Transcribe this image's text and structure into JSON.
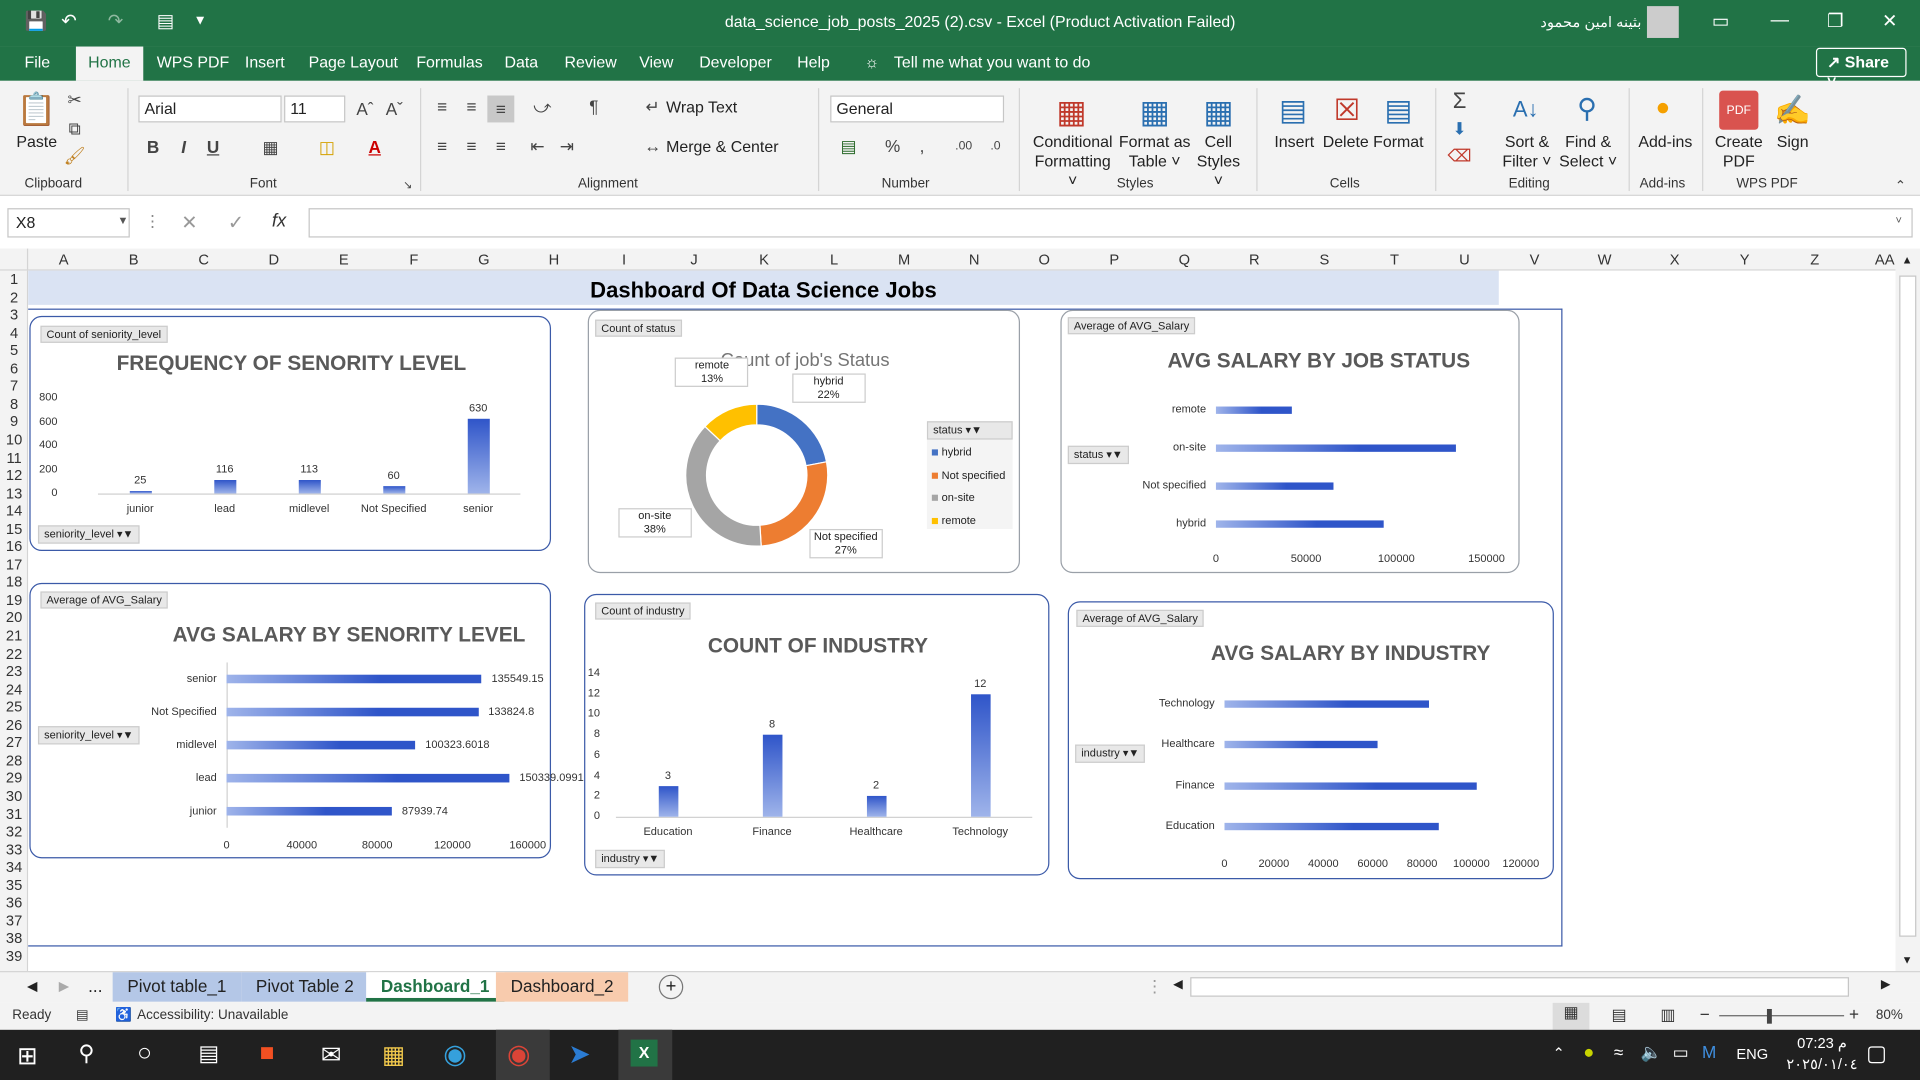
{
  "window": {
    "title": "data_science_job_posts_2025 (2).csv  -  Excel (Product Activation Failed)",
    "user": "بثينه امين محمود"
  },
  "menu": {
    "file": "File",
    "home": "Home",
    "wps_pdf": "WPS PDF",
    "insert": "Insert",
    "page_layout": "Page Layout",
    "formulas": "Formulas",
    "data": "Data",
    "review": "Review",
    "view": "View",
    "developer": "Developer",
    "help": "Help",
    "tell_me": "Tell me what you want to do",
    "share": "Share"
  },
  "ribbon": {
    "paste": "Paste",
    "clipboard": "Clipboard",
    "font_name": "Arial",
    "font_size": "11",
    "font": "Font",
    "wrap_text": "Wrap Text",
    "merge_center": "Merge & Center",
    "alignment": "Alignment",
    "number_format": "General",
    "number": "Number",
    "conditional_1": "Conditional",
    "conditional_2": "Formatting",
    "format_table_1": "Format as",
    "format_table_2": "Table",
    "cell_styles_1": "Cell",
    "cell_styles_2": "Styles",
    "styles": "Styles",
    "insert": "Insert",
    "delete": "Delete",
    "format": "Format",
    "cells": "Cells",
    "sort_1": "Sort &",
    "sort_2": "Filter",
    "find_1": "Find &",
    "find_2": "Select",
    "editing": "Editing",
    "addins": "Add-ins",
    "addins_group": "Add-ins",
    "create_pdf_1": "Create",
    "create_pdf_2": "PDF",
    "sign": "Sign",
    "wps_pdf_group": "WPS PDF"
  },
  "formula_bar": {
    "name_box": "X8",
    "formula": ""
  },
  "columns": [
    "A",
    "B",
    "C",
    "D",
    "E",
    "F",
    "G",
    "H",
    "I",
    "J",
    "K",
    "L",
    "M",
    "N",
    "O",
    "P",
    "Q",
    "R",
    "S",
    "T",
    "U",
    "V",
    "W",
    "X",
    "Y",
    "Z",
    "AA"
  ],
  "rows": [
    "1",
    "2",
    "3",
    "4",
    "5",
    "6",
    "7",
    "8",
    "9",
    "10",
    "11",
    "12",
    "13",
    "14",
    "15",
    "16",
    "17",
    "18",
    "19",
    "20",
    "21",
    "22",
    "23",
    "24",
    "25",
    "26",
    "27",
    "28",
    "29",
    "30",
    "31",
    "32",
    "33",
    "34",
    "35",
    "36",
    "37",
    "38",
    "39"
  ],
  "dashboard_title": "Dashboard Of Data Science Jobs",
  "chart_data": [
    {
      "type": "bar",
      "tag": "Count of seniority_level",
      "title": "FREQUENCY OF SENORITY LEVEL",
      "categories": [
        "junior",
        "lead",
        "midlevel",
        "Not Specified",
        "senior"
      ],
      "values": [
        25,
        116,
        113,
        60,
        630
      ],
      "yticks": [
        "800",
        "600",
        "400",
        "200",
        "0"
      ],
      "ylim": [
        0,
        800
      ],
      "filter": "seniority_level"
    },
    {
      "type": "pie",
      "tag": "Count of status",
      "title": "Count of job's Status",
      "legend_title": "status",
      "categories": [
        "hybrid",
        "Not specified",
        "on-site",
        "remote"
      ],
      "labels": [
        [
          "hybrid",
          "22%"
        ],
        [
          "Not specified",
          "27%"
        ],
        [
          "on-site",
          "38%"
        ],
        [
          "remote",
          "13%"
        ]
      ],
      "values": [
        22,
        27,
        38,
        13
      ],
      "colors": [
        "#4472c4",
        "#ed7d31",
        "#a5a5a5",
        "#ffc000"
      ]
    },
    {
      "type": "bar",
      "orientation": "horizontal",
      "tag": "Average of AVG_Salary",
      "title": "AVG SALARY BY JOB STATUS",
      "categories": [
        "remote",
        "on-site",
        "Not specified",
        "hybrid"
      ],
      "values": [
        42000,
        133000,
        65000,
        93000
      ],
      "xticks": [
        "0",
        "50000",
        "100000",
        "150000"
      ],
      "xlim": [
        0,
        150000
      ],
      "filter": "status"
    },
    {
      "type": "bar",
      "orientation": "horizontal",
      "tag": "Average of AVG_Salary",
      "title": "AVG SALARY BY SENORITY LEVEL",
      "categories": [
        "senior",
        "Not Specified",
        "midlevel",
        "lead",
        "junior"
      ],
      "values": [
        135549.15,
        133824.8,
        100323.6018,
        150339.0991,
        87939.74
      ],
      "labels": [
        "135549.15",
        "133824.8",
        "100323.6018",
        "150339.0991",
        "87939.74"
      ],
      "xticks": [
        "0",
        "40000",
        "80000",
        "120000",
        "160000"
      ],
      "xlim": [
        0,
        160000
      ],
      "filter": "seniority_level"
    },
    {
      "type": "bar",
      "tag": "Count of industry",
      "title": "COUNT OF INDUSTRY",
      "categories": [
        "Education",
        "Finance",
        "Healthcare",
        "Technology"
      ],
      "values": [
        3,
        8,
        2,
        12
      ],
      "yticks": [
        "14",
        "12",
        "10",
        "8",
        "6",
        "4",
        "2",
        "0"
      ],
      "ylim": [
        0,
        14
      ],
      "filter": "industry"
    },
    {
      "type": "bar",
      "orientation": "horizontal",
      "tag": "Average of AVG_Salary",
      "title": "AVG SALARY BY INDUSTRY",
      "categories": [
        "Technology",
        "Healthcare",
        "Finance",
        "Education"
      ],
      "values": [
        83000,
        62000,
        102000,
        87000
      ],
      "xticks": [
        "0",
        "20000",
        "40000",
        "60000",
        "80000",
        "100000",
        "120000"
      ],
      "xlim": [
        0,
        120000
      ],
      "filter": "industry"
    }
  ],
  "sheet_tabs": [
    "Pivot table_1",
    "Pivot Table 2",
    "Dashboard_1",
    "Dashboard_2"
  ],
  "status": {
    "ready": "Ready",
    "accessibility": "Accessibility: Unavailable",
    "zoom": "80%"
  },
  "taskbar": {
    "time": "07:23 م",
    "date": "٢٠٢٥/٠١/٠٤",
    "lang": "ENG"
  }
}
